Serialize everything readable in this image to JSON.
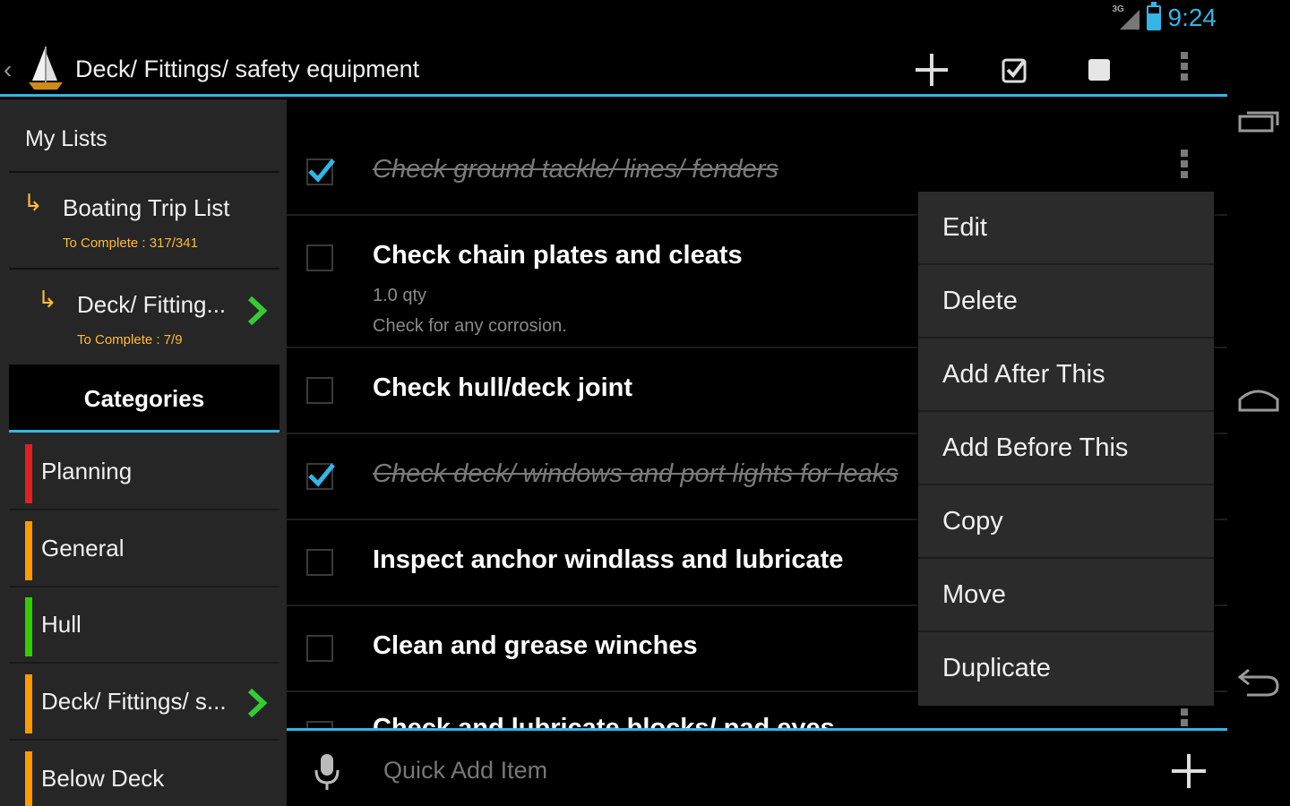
{
  "status": {
    "network": "3G",
    "time": "9:24"
  },
  "actionbar": {
    "title": "Deck/ Fittings/ safety equipment",
    "icons": [
      "add-icon",
      "check-all-icon",
      "uncheck-all-icon",
      "overflow-menu-icon"
    ]
  },
  "sidebar": {
    "my_lists_label": "My Lists",
    "lists": [
      {
        "name": "Boating Trip List",
        "sub": "To Complete : 317/341"
      },
      {
        "name": "Deck/ Fitting...",
        "sub": "To Complete : 7/9"
      }
    ],
    "categories_label": "Categories",
    "categories": [
      {
        "label": "Planning",
        "color": "#e02020"
      },
      {
        "label": "General",
        "color": "#ff9900"
      },
      {
        "label": "Hull",
        "color": "#33cc00"
      },
      {
        "label": "Deck/ Fittings/ s...",
        "color": "#ff9900"
      },
      {
        "label": "Below Deck",
        "color": "#ff9900"
      }
    ]
  },
  "items": [
    {
      "title": "Check ground tackle/ lines/ fenders",
      "checked": true
    },
    {
      "title": "Check chain plates and cleats",
      "checked": false,
      "qty": "1.0 qty",
      "note": "Check for any corrosion."
    },
    {
      "title": "Check hull/deck joint",
      "checked": false
    },
    {
      "title": "Check deck/ windows and port lights for leaks",
      "checked": true
    },
    {
      "title": "Inspect anchor windlass and lubricate",
      "checked": false
    },
    {
      "title": "Clean and grease winches",
      "checked": false
    },
    {
      "title": "Check and lubricate blocks/ pad eyes",
      "checked": false
    }
  ],
  "context_menu": [
    "Edit",
    "Delete",
    "Add After This",
    "Add Before This",
    "Copy",
    "Move",
    "Duplicate"
  ],
  "quick_add": {
    "placeholder": "Quick Add Item"
  },
  "colors": {
    "accent": "#33b5e5",
    "completion": "#ffbb33",
    "arrow_green": "#33cc33"
  }
}
